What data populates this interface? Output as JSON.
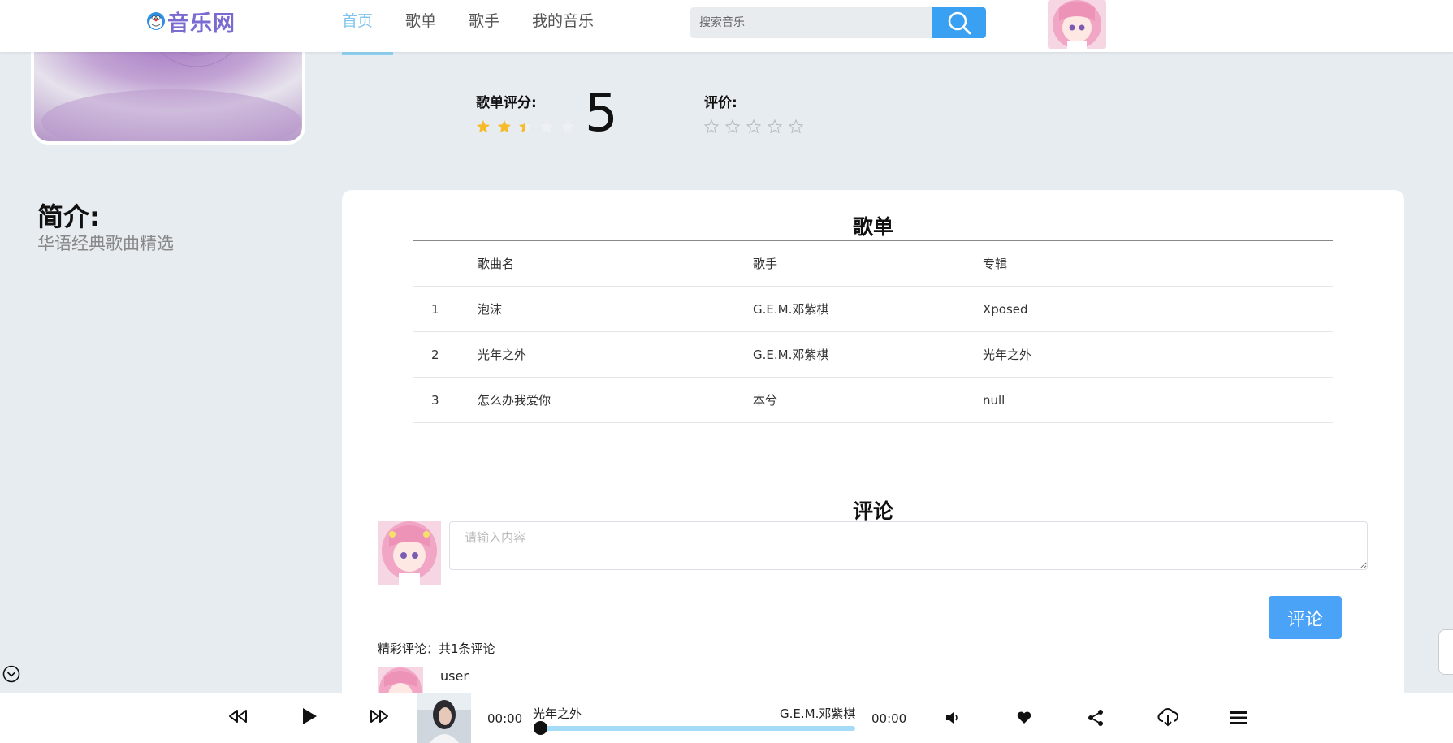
{
  "header": {
    "logo_text": "音乐网",
    "nav": [
      "首页",
      "歌单",
      "歌手",
      "我的音乐"
    ],
    "active_nav": 0,
    "search_placeholder": "搜索音乐"
  },
  "rating": {
    "label": "歌单评分:",
    "value": "5",
    "stars_filled": 2.5,
    "stars_total": 5
  },
  "evaluate": {
    "label": "评价:",
    "stars_total": 5
  },
  "intro": {
    "title": "简介:",
    "text": "华语经典歌曲精选"
  },
  "playlist": {
    "title": "歌单",
    "columns": [
      "歌曲名",
      "歌手",
      "专辑"
    ],
    "rows": [
      {
        "idx": "1",
        "name": "泡沫",
        "singer": "G.E.M.邓紫棋",
        "album": "Xposed"
      },
      {
        "idx": "2",
        "name": "光年之外",
        "singer": "G.E.M.邓紫棋",
        "album": "光年之外"
      },
      {
        "idx": "3",
        "name": "怎么办我爱你",
        "singer": "本兮",
        "album": "null"
      }
    ]
  },
  "comments": {
    "title": "评论",
    "placeholder": "请输入内容",
    "submit_label": "评论",
    "count_text": "精彩评论：共1条评论",
    "items": [
      {
        "user": "user"
      }
    ]
  },
  "player": {
    "current_time": "00:00",
    "total_time": "00:00",
    "song_title": "光年之外",
    "artist": "G.E.M.邓紫棋",
    "progress": 0
  },
  "colors": {
    "accent": "#3aa0f2",
    "nav_active": "#7fc4ee",
    "star": "#f7ba2a",
    "logo": "#7a6bd1"
  }
}
